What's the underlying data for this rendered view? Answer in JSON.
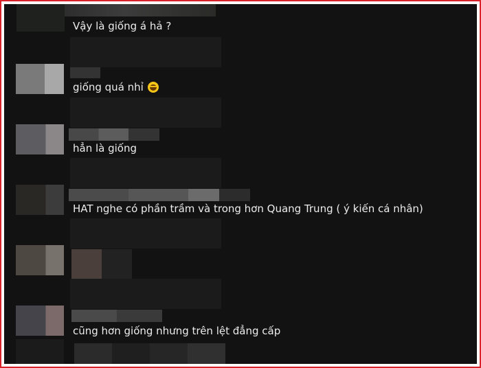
{
  "comments": [
    {
      "text": "Vậy là giống á hả ?"
    },
    {
      "text": "giống quá nhỉ",
      "emoji": "grinning-squinting-face-icon"
    },
    {
      "text": "hẳn là giống"
    },
    {
      "text": "HAT nghe có phần trầm và trong hơn Quang Trung ( ý kiến cá nhân)"
    },
    {
      "text": "cũng hơn giống nhưng trên lệt đẳng cấp"
    }
  ]
}
